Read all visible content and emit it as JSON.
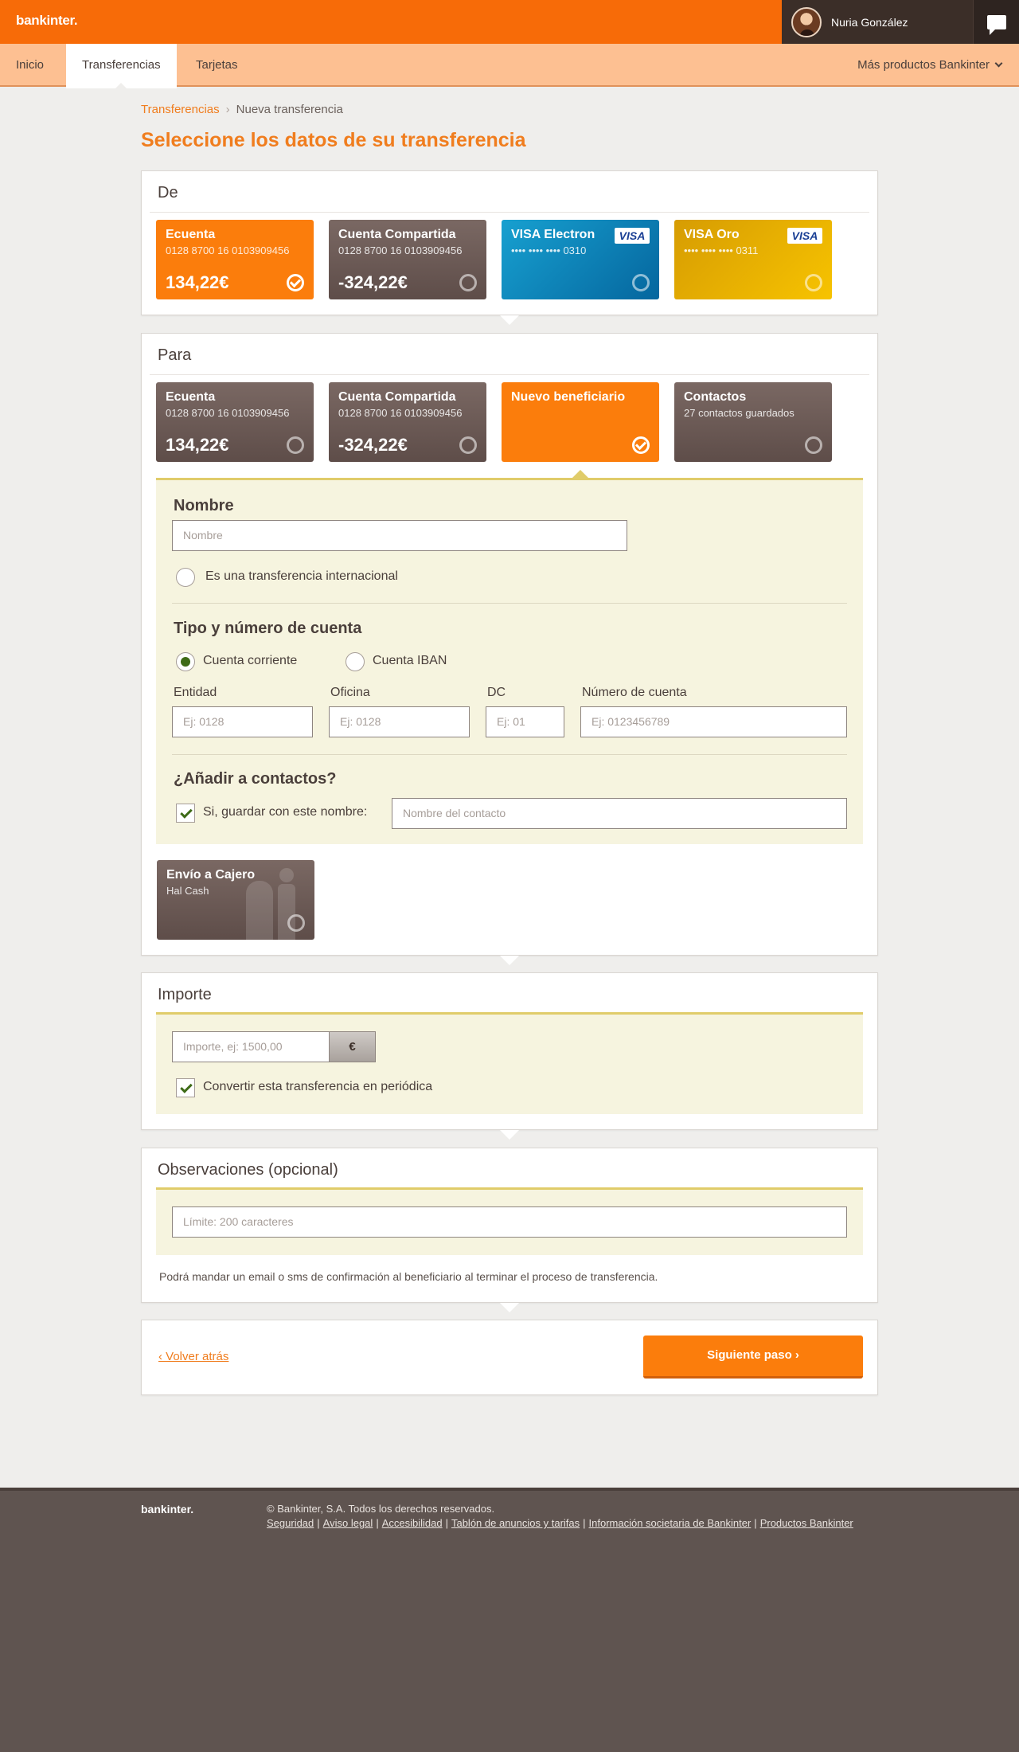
{
  "header": {
    "logo": "bankinter.",
    "user_name": "Nuria González",
    "chat_icon": "chat-bubble-icon"
  },
  "nav": {
    "items": [
      "Inicio",
      "Transferencias",
      "Tarjetas"
    ],
    "active": "Transferencias",
    "more_products": "Más productos Bankinter"
  },
  "breadcrumb": {
    "parent": "Transferencias",
    "separator": "›",
    "current": "Nueva transferencia"
  },
  "page_title": "Seleccione los datos de su transferencia",
  "de": {
    "title": "De",
    "cards": [
      {
        "title": "Ecuenta",
        "sub": "0128 8700 16 0103909456",
        "amount": "134,22€",
        "selected": true
      },
      {
        "title": "Cuenta Compartida",
        "sub": "0128 8700 16 0103909456",
        "amount": "-324,22€",
        "selected": false
      },
      {
        "title": "VISA Electron",
        "sub": "•••• •••• •••• 0310",
        "badge": "VISA",
        "selected": false
      },
      {
        "title": "VISA Oro",
        "sub": "•••• •••• •••• 0311",
        "badge": "VISA",
        "selected": false
      }
    ]
  },
  "para": {
    "title": "Para",
    "cards": [
      {
        "title": "Ecuenta",
        "sub": "0128 8700 16 0103909456",
        "amount": "134,22€",
        "selected": false
      },
      {
        "title": "Cuenta Compartida",
        "sub": "0128 8700 16 0103909456",
        "amount": "-324,22€",
        "selected": false
      },
      {
        "title": "Nuevo beneficiario",
        "selected": true
      },
      {
        "title": "Contactos",
        "sub": "27 contactos guardados",
        "selected": false
      }
    ],
    "form": {
      "nombre_label": "Nombre",
      "nombre_placeholder": "Nombre",
      "internacional_label": "Es una transferencia internacional",
      "tipo_label": "Tipo y número de cuenta",
      "tipo_options": [
        "Cuenta corriente",
        "Cuenta IBAN"
      ],
      "tipo_selected": "Cuenta corriente",
      "fields": [
        {
          "label": "Entidad",
          "placeholder": "Ej: 0128"
        },
        {
          "label": "Oficina",
          "placeholder": "Ej: 0128"
        },
        {
          "label": "DC",
          "placeholder": "Ej: 01"
        },
        {
          "label": "Número de cuenta",
          "placeholder": "Ej: 0123456789"
        }
      ],
      "contactos_label": "¿Añadir a contactos?",
      "guardar_label": "Si, guardar con este nombre:",
      "guardar_checked": true,
      "contacto_placeholder": "Nombre del contacto"
    },
    "cajero": {
      "title": "Envío a Cajero",
      "sub": "Hal Cash",
      "selected": false
    }
  },
  "importe": {
    "title": "Importe",
    "placeholder": "Importe, ej: 1500,00",
    "currency": "€",
    "periodica_label": "Convertir esta transferencia en periódica",
    "periodica_checked": true
  },
  "observaciones": {
    "title": "Observaciones (opcional)",
    "placeholder": "Límite: 200 caracteres",
    "note": "Podrá mandar un email o sms de confirmación al beneficiario al terminar el proceso de transferencia."
  },
  "actions": {
    "back": "‹ Volver atrás",
    "next": "Siguiente paso ›"
  },
  "footer": {
    "logo": "bankinter.",
    "copyright": "© Bankinter, S.A. Todos los derechos reservados.",
    "links": [
      "Seguridad",
      "Aviso legal",
      "Accesibilidad",
      "Tablón de anuncios y tarifas",
      "Información societaria de Bankinter",
      "Productos Bankinter"
    ]
  },
  "colors": {
    "brand_orange": "#f76b08",
    "nav_peach": "#fdc092",
    "form_cream": "#f6f4df",
    "accent_yellow": "#e0cc6a",
    "footer_brown": "#5f5450"
  }
}
